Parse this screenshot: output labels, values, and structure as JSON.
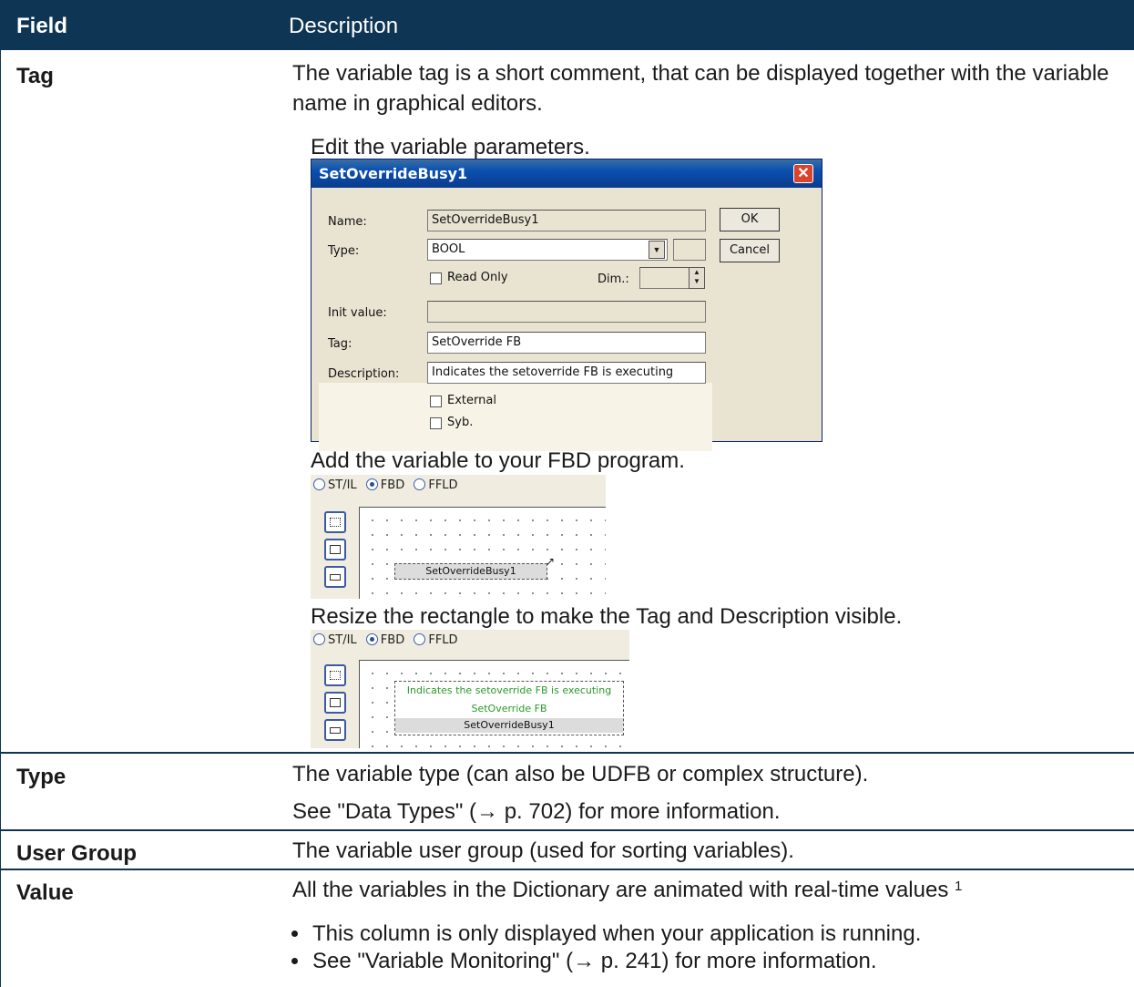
{
  "header": {
    "field_col": "Field",
    "description_col": "Description"
  },
  "rows": {
    "tag": {
      "field": "Tag",
      "description": "The variable tag is a short comment, that can be displayed together with the variable name in graphical editors.",
      "step1": "Edit the variable parameters.",
      "step2": "Add the variable to your FBD program.",
      "step3": "Resize the rectangle to make the Tag and Description visible."
    },
    "type": {
      "field": "Type",
      "line1": "The variable type (can also be UDFB or complex structure).",
      "line2": "See \"Data Types\" (→ p. 702) for more information."
    },
    "user_group": {
      "field": "User Group",
      "description": "The variable user group (used for sorting variables)."
    },
    "value": {
      "field": "Value",
      "description": "All the variables in the Dictionary are animated with real-time values",
      "footnote": "1",
      "bullets": [
        "This column is only displayed when your application is running.",
        "See \"Variable Monitoring\" (→ p. 241) for more information."
      ]
    }
  },
  "dialog": {
    "title": "SetOverrideBusy1",
    "close": "✕",
    "labels": {
      "name": "Name:",
      "type": "Type:",
      "read_only": "Read Only",
      "dim": "Dim.:",
      "init_value": "Init value:",
      "tag": "Tag:",
      "description": "Description:",
      "external": "External",
      "syb": "Syb."
    },
    "values": {
      "name": "SetOverrideBusy1",
      "type": "BOOL",
      "init_value": "",
      "tag": "SetOverride FB",
      "description": "Indicates the setoverride FB is executing"
    },
    "buttons": {
      "ok": "OK",
      "cancel": "Cancel"
    }
  },
  "fbd": {
    "modes": [
      "ST/IL",
      "FBD",
      "FFLD"
    ],
    "selected_mode": "FBD",
    "block_name": "SetOverrideBusy1",
    "block_tag": "SetOverride FB",
    "block_description": "Indicates the setoverride FB is executing"
  },
  "colors": {
    "header_bg": "#0e3553",
    "tag_text": "#2a9a2a",
    "dialog_title": "#0a4fb0"
  }
}
